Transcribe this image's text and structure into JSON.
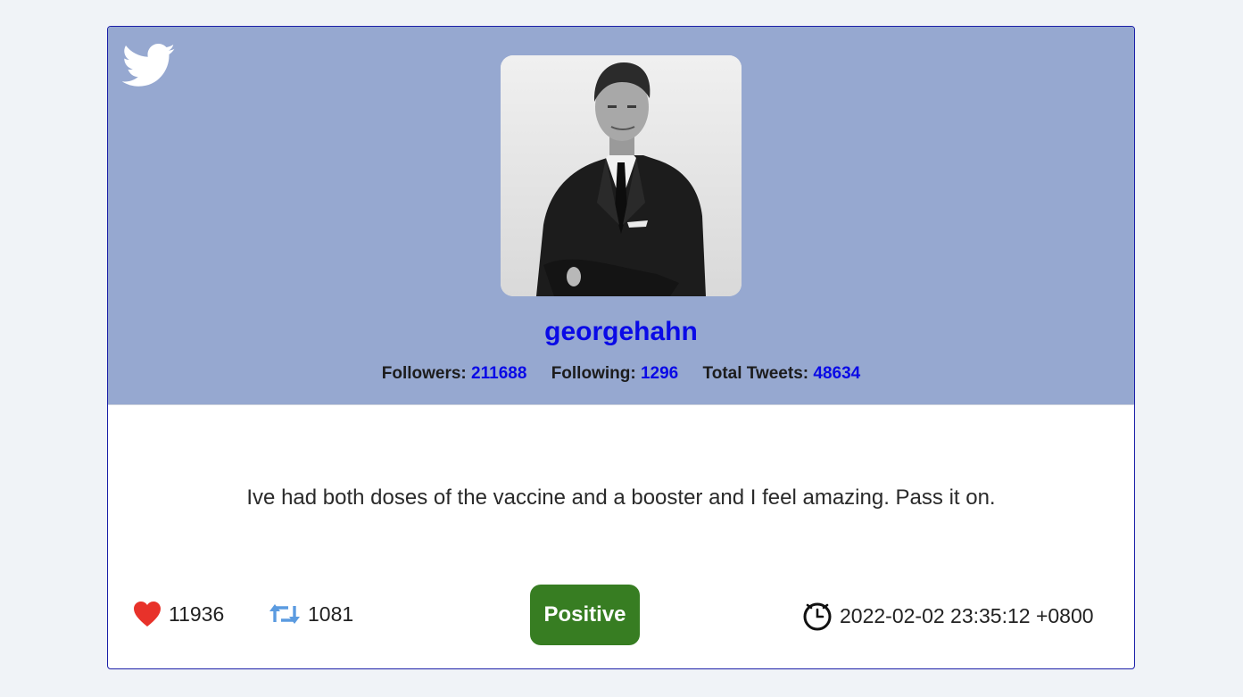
{
  "profile": {
    "username": "georgehahn",
    "followers_label": "Followers:",
    "followers": "211688",
    "following_label": "Following:",
    "following": "1296",
    "tweets_label": "Total Tweets:",
    "tweets": "48634"
  },
  "tweet": {
    "text": "Ive had both doses of the vaccine and a booster and I feel amazing. Pass it on.",
    "likes": "11936",
    "retweets": "1081",
    "sentiment": "Positive",
    "timestamp": "2022-02-02 23:35:12 +0800"
  },
  "icons": {
    "brand": "twitter-bird-icon",
    "likes": "heart-icon",
    "retweets": "retweet-icon",
    "timestamp": "clock-icon"
  },
  "colors": {
    "header_bg": "#96a8d0",
    "link": "#0a0ae6",
    "heart": "#e8322a",
    "retweet": "#5b9be0",
    "positive": "#377d22"
  }
}
